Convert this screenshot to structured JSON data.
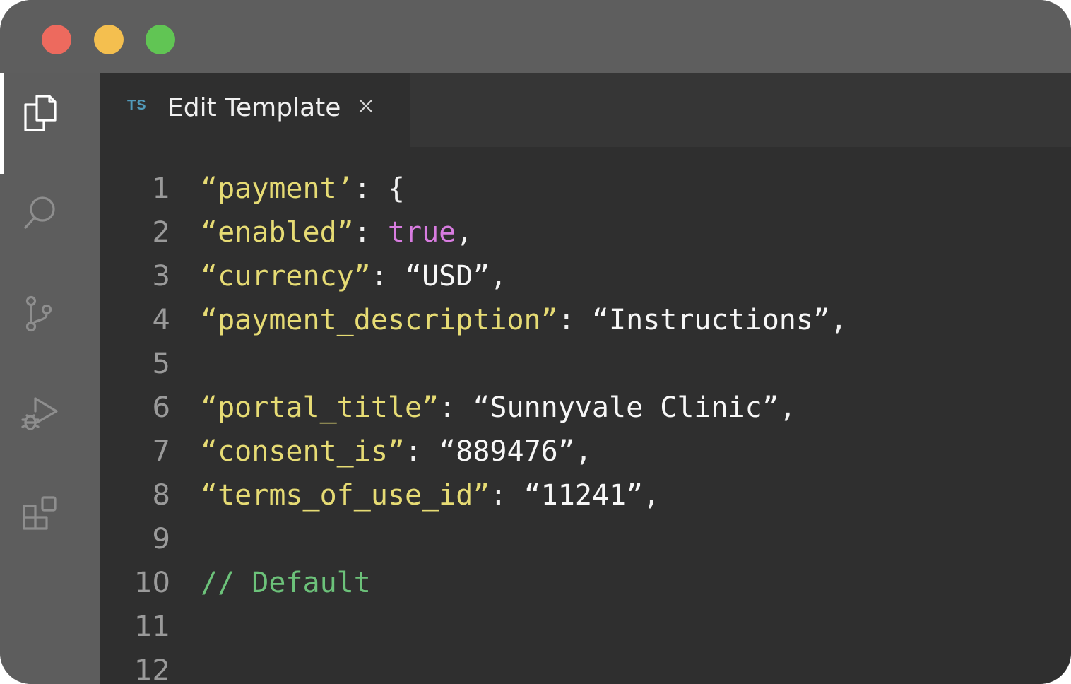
{
  "window": {
    "traffic_lights": {
      "close_color": "#ed6a5e",
      "minimize_color": "#f4bf4f",
      "maximize_color": "#61c554"
    }
  },
  "activity_bar": {
    "items": [
      {
        "icon": "files-icon",
        "active": true
      },
      {
        "icon": "search-icon",
        "active": false
      },
      {
        "icon": "source-control-icon",
        "active": false
      },
      {
        "icon": "run-debug-icon",
        "active": false
      },
      {
        "icon": "extensions-icon",
        "active": false
      }
    ]
  },
  "tab": {
    "lang_badge": "TS",
    "title": "Edit Template",
    "close_glyph": "×"
  },
  "colors": {
    "key": "#e6db74",
    "punct": "#f2f2f2",
    "string": "#f7f7f7",
    "boolean": "#d87ce0",
    "comment": "#6cc27a",
    "line_number": "#9a9a9a"
  },
  "code": {
    "line_numbers": [
      "1",
      "2",
      "3",
      "4",
      "5",
      "6",
      "7",
      "8",
      "9",
      "10",
      "11",
      "12"
    ],
    "l1": {
      "key": "“payment’",
      "punct": ": {"
    },
    "l2": {
      "key": "“enabled”",
      "punct": ": ",
      "value": "true",
      "tail": ","
    },
    "l3": {
      "key": "“currency”",
      "punct": ": ",
      "value": "“USD”",
      "tail": ","
    },
    "l4": {
      "key": "“payment_description”",
      "punct": ": ",
      "value": "“Instructions”",
      "tail": ","
    },
    "l6": {
      "key": "“portal_title”",
      "punct": ": ",
      "value": "“Sunnyvale Clinic”",
      "tail": ","
    },
    "l7": {
      "key": "“consent_is”",
      "punct": ": ",
      "value": "“889476”",
      "tail": ","
    },
    "l8": {
      "key": "“terms_of_use_id”",
      "punct": ": ",
      "value": "“11241”",
      "tail": ","
    },
    "l10": {
      "comment": "// Default"
    }
  }
}
